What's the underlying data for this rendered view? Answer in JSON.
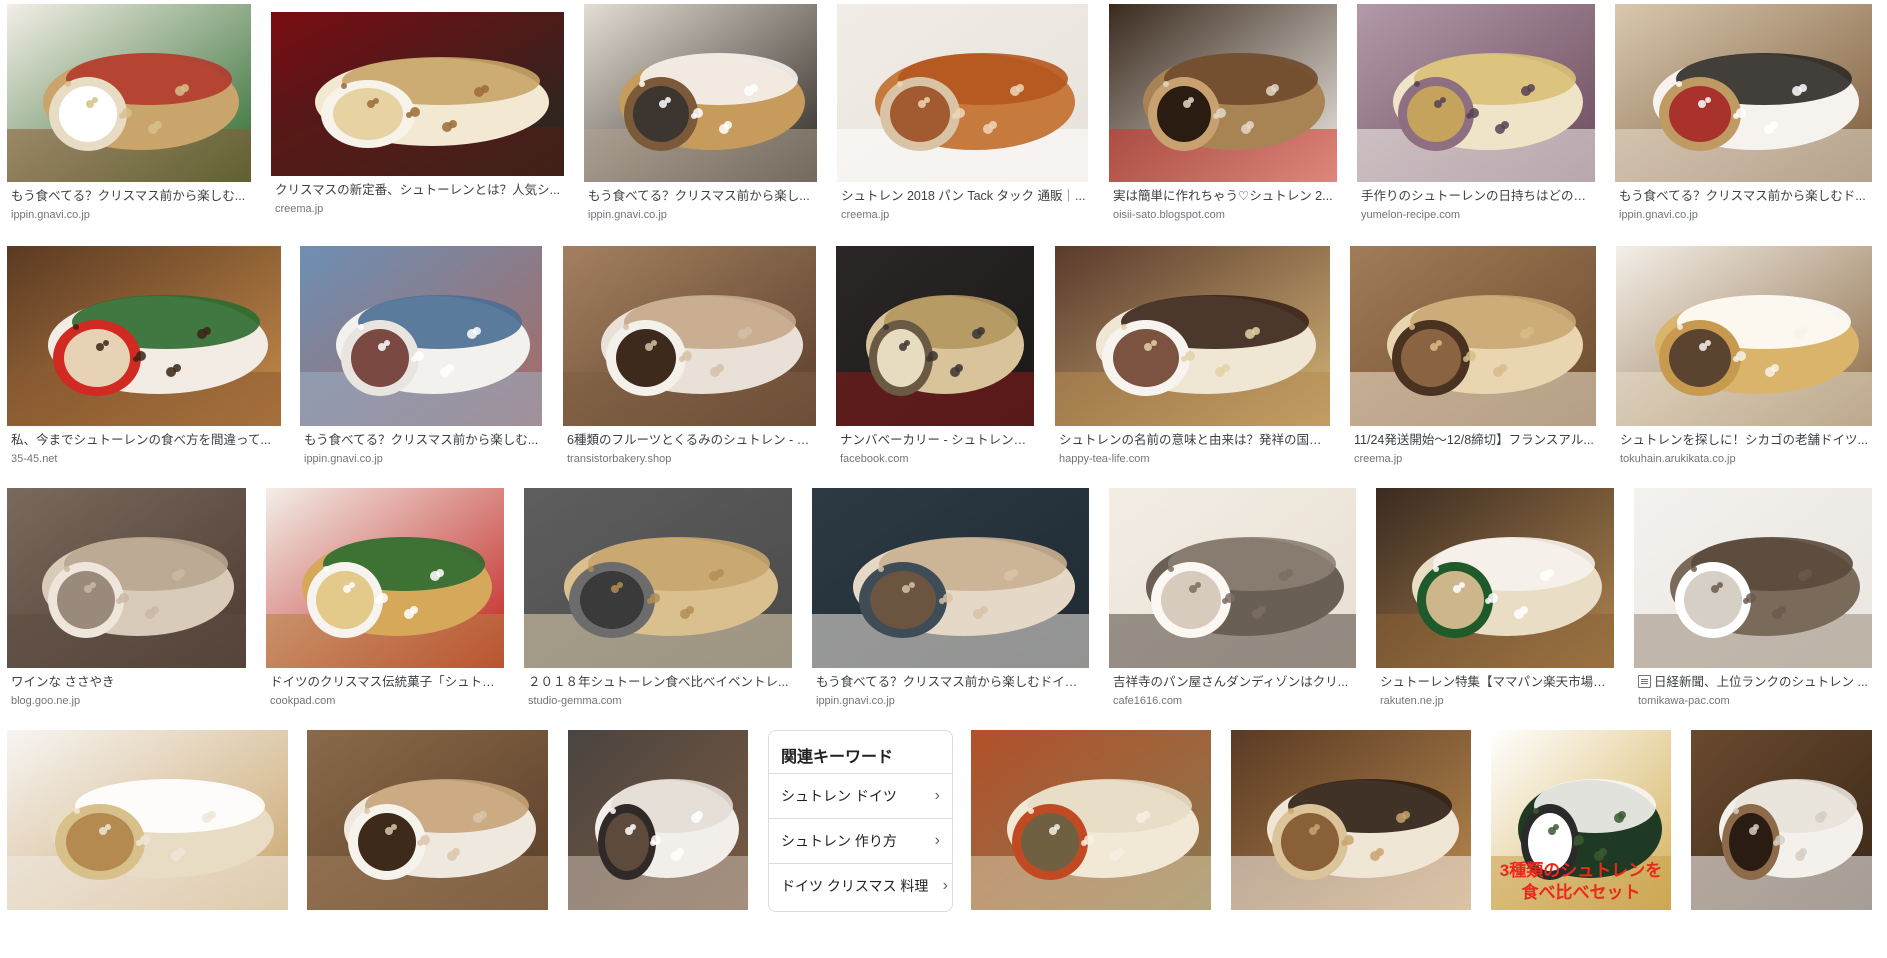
{
  "results": [
    {
      "title": "もう食べてる？クリスマス前から楽しむ...",
      "source": "ippin.gnavi.co.jp",
      "colors": [
        "#f3eee6",
        "#c9a46b",
        "#2d6a2f",
        "#b23a2e",
        "#e8dcc5",
        "#8c5a34",
        "#ffffff",
        "#d7c08a"
      ]
    },
    {
      "title": "クリスマスの新定番、シュトーレンとは？人気シ...",
      "source": "creema.jp",
      "colors": [
        "#7a0c12",
        "#f3e9d2",
        "#1f2a22",
        "#c8a567",
        "#f7f3ea",
        "#5a1b16",
        "#e7d3a1",
        "#9b6a35"
      ]
    },
    {
      "title": "もう食べてる？クリスマス前から楽し...",
      "source": "ippin.gnavi.co.jp",
      "colors": [
        "#e3ddd3",
        "#c69b5b",
        "#2c2621",
        "#f6f3ee",
        "#7b5a3a",
        "#b0a28f",
        "#3c3530",
        "#ffffff"
      ]
    },
    {
      "title": "シュトレン 2018 パン Tack タック 通販｜...",
      "source": "creema.jp",
      "colors": [
        "#f1ece6",
        "#c77a3e",
        "#e8e2dc",
        "#b5561f",
        "#d9c3a5",
        "#ffffff",
        "#a25a30",
        "#f0d6b9"
      ]
    },
    {
      "title": "実は簡単に作れちゃう♡シュトレン 2...",
      "source": "oisii-sato.blogspot.com",
      "colors": [
        "#3a2a1e",
        "#a88455",
        "#f0ece6",
        "#6e4a2c",
        "#c9a070",
        "#d23126",
        "#2b1c12",
        "#e3d7c5"
      ]
    },
    {
      "title": "手作りのシュトーレンの日持ちはどのく...",
      "source": "yumelon-recipe.com",
      "colors": [
        "#b39aa8",
        "#f0e4c8",
        "#6b4a5c",
        "#d9c077",
        "#8e6f82",
        "#f8f4ee",
        "#c5a35c",
        "#574152"
      ]
    },
    {
      "title": "もう食べてる？クリスマス前から楽しむド...",
      "source": "ippin.gnavi.co.jp",
      "colors": [
        "#d9c8ae",
        "#f6f3ee",
        "#7b5a3a",
        "#2f2a26",
        "#c09a63",
        "#e8dfd2",
        "#a9322d",
        "#ffffff"
      ]
    },
    {
      "title": "私、今までシュトーレンの食べ方を間違って...",
      "source": "35-45.net",
      "colors": [
        "#5b3a22",
        "#f2ece4",
        "#c78c4a",
        "#2e6b2f",
        "#d02a22",
        "#8a5a32",
        "#e7d2b5",
        "#3b2414"
      ]
    },
    {
      "title": "もう食べてる？クリスマス前から楽しむ...",
      "source": "ippin.gnavi.co.jp",
      "colors": [
        "#6d8fb4",
        "#f3f1ee",
        "#a86a62",
        "#4a6e93",
        "#e8e4e0",
        "#9ab0c8",
        "#7a4a42",
        "#ffffff"
      ]
    },
    {
      "title": "6種類のフルーツとくるみのシュトレン - ト...",
      "source": "transistorbakery.shop",
      "colors": [
        "#a48060",
        "#e9e1d8",
        "#5a3e2a",
        "#c7a98a",
        "#f4f0ea",
        "#7d5d42",
        "#3d2a1c",
        "#d3bfa6"
      ]
    },
    {
      "title": "ナンバベーカリー - シュトレン切...",
      "source": "facebook.com",
      "colors": [
        "#2a2726",
        "#d8c39a",
        "#1b1918",
        "#b3975f",
        "#6a5a44",
        "#8c1a1a",
        "#e8dcc0",
        "#3a3431"
      ]
    },
    {
      "title": "シュトレンの名前の意味と由来は？発祥の国と...",
      "source": "happy-tea-life.com",
      "colors": [
        "#5a3a2c",
        "#efe6d4",
        "#d4b477",
        "#3a241a",
        "#f7f4ef",
        "#b48a50",
        "#7b5340",
        "#e3d2a8"
      ]
    },
    {
      "title": "11/24発送開始〜12/8締切】フランスアル...",
      "source": "creema.jp",
      "colors": [
        "#a17c57",
        "#e9d6b0",
        "#6b4a2e",
        "#c9a772",
        "#4a3220",
        "#f2e6cf",
        "#8a6440",
        "#d8bb8a"
      ]
    },
    {
      "title": "シュトレンを探しに！シカゴの老舗ドイツ...",
      "source": "tokuhain.arukikata.co.jp",
      "colors": [
        "#f4efe8",
        "#d9b46a",
        "#8a6a44",
        "#ffffff",
        "#c79a50",
        "#e8dcc6",
        "#5a4430",
        "#f7f2ea"
      ]
    },
    {
      "title": "ワインな ささやき",
      "source": "blog.goo.ne.jp",
      "colors": [
        "#7a6a5e",
        "#d9cbb9",
        "#4a3a30",
        "#b8a690",
        "#eee6db",
        "#5e4d41",
        "#9a8a7c",
        "#c9b8a3"
      ]
    },
    {
      "title": "ドイツのクリスマス伝統菓子「シュトレ...",
      "source": "cookpad.com",
      "colors": [
        "#f3eee8",
        "#d6a85a",
        "#c0201c",
        "#2d6a30",
        "#f7f3ee",
        "#b5823f",
        "#e3c98a",
        "#ffffff"
      ]
    },
    {
      "title": "２０１８年シュトーレン食べ比べイベントレ...",
      "source": "studio-gemma.com",
      "colors": [
        "#5e5e5e",
        "#d9c08e",
        "#4a4a4a",
        "#c6a56e",
        "#6c6c6c",
        "#e3d3b0",
        "#3a3a3a",
        "#b38e52"
      ]
    },
    {
      "title": "もう食べてる？クリスマス前から楽しむドイツ...",
      "source": "ippin.gnavi.co.jp",
      "colors": [
        "#2d3a44",
        "#e6d8c6",
        "#1f2a32",
        "#c9b091",
        "#3e4c57",
        "#f2ebe1",
        "#6b5540",
        "#d6c3a8"
      ]
    },
    {
      "title": "吉祥寺のパン屋さんダンディゾンはクリ...",
      "source": "cafe1616.com",
      "colors": [
        "#f3ede4",
        "#6a5f55",
        "#e8dfd2",
        "#8c7f73",
        "#fbf8f3",
        "#4e443c",
        "#d6cbbd",
        "#7a6d62"
      ]
    },
    {
      "title": "シュトーレン特集【ママパン楽天市場店...",
      "source": "rakuten.ne.jp",
      "colors": [
        "#3a2a20",
        "#e9ddc6",
        "#b08650",
        "#f6f2ec",
        "#1f5a2a",
        "#8a6035",
        "#cdb68c",
        "#ffffff"
      ]
    },
    {
      "title": "日経新聞、上位ランクのシュトレン ...",
      "source": "tomikawa-pac.com",
      "hasIcon": true,
      "colors": [
        "#f4f2ef",
        "#7a6a5a",
        "#e9e5df",
        "#5a4a3c",
        "#ffffff",
        "#9a8a7a",
        "#d6cfc5",
        "#6a5a4c"
      ]
    },
    {
      "title": "",
      "source": "",
      "colors": [
        "#f7f5f2",
        "#e8dcc5",
        "#c9a46b",
        "#ffffff",
        "#d7c08a",
        "#f0ebe3",
        "#b48a50",
        "#eee6d8"
      ]
    },
    {
      "title": "",
      "source": "",
      "colors": [
        "#8a6a4a",
        "#efe8de",
        "#5a3e28",
        "#c6a37a",
        "#f6f2ec",
        "#a3805c",
        "#3e2a1a",
        "#d9c6aa"
      ]
    },
    {
      "title": "",
      "source": "",
      "colors": [
        "#4a4440",
        "#f2eee9",
        "#7a5a42",
        "#e3ddd6",
        "#2f2a27",
        "#c9bcae",
        "#5e4a3a",
        "#ffffff"
      ]
    },
    {
      "title": "",
      "source": "",
      "colors": [
        "#b2502a",
        "#f1e8d6",
        "#8a7a50",
        "#e7dcc5",
        "#c24a22",
        "#d8c9a6",
        "#6e6040",
        "#f6f0e4"
      ]
    },
    {
      "title": "",
      "source": "",
      "colors": [
        "#5a3a24",
        "#efe6d6",
        "#b8894e",
        "#2e1e14",
        "#dcc49a",
        "#f7f3ec",
        "#8a6038",
        "#c9a46e"
      ]
    },
    {
      "title": "",
      "source": "",
      "colors": [
        "#ffffff",
        "#1f3a24",
        "#d4b15a",
        "#f7f5f2",
        "#2a2a2a",
        "#c8a04a",
        "#ffffff",
        "#3a5a30"
      ]
    },
    {
      "title": "",
      "source": "",
      "colors": [
        "#6a4a2e",
        "#f4f1ec",
        "#3a2818",
        "#e8e2da",
        "#8c6a4a",
        "#ffffff",
        "#2a1c12",
        "#d6cdc2"
      ]
    }
  ],
  "ad_caption": {
    "line1": "3種類のシュトレンを",
    "line2": "食べ比べセット"
  },
  "related": {
    "title": "関連キーワード",
    "items": [
      "シュトレン ドイツ",
      "シュトレン 作り方",
      "ドイツ クリスマス 料理"
    ]
  },
  "accent_color": "#e8291c"
}
